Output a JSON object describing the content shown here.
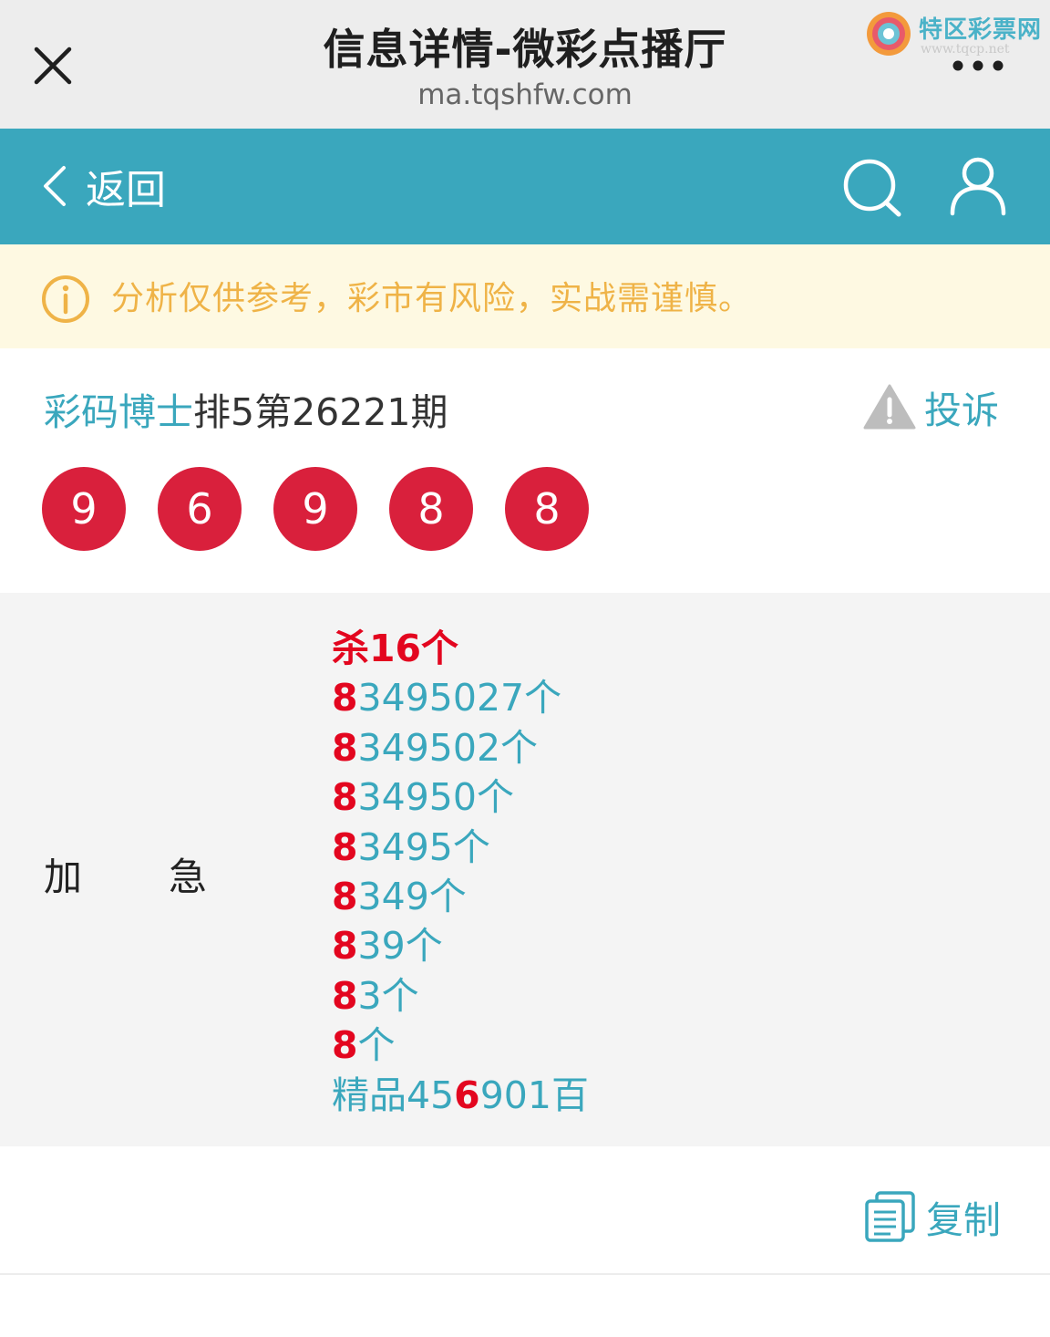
{
  "window": {
    "title": "信息详情-微彩点播厅",
    "url": "ma.tqshfw.com",
    "watermark": "特区彩票网",
    "watermark_sub": "www.tqcp.net"
  },
  "nav": {
    "back_label": "返回",
    "search_icon": "search-icon",
    "user_icon": "user-icon",
    "bg_color": "#3aa7bd"
  },
  "notice": {
    "text": "分析仅供参考，彩市有风险，实战需谨慎。",
    "icon": "info-icon",
    "text_color": "#efb347"
  },
  "post": {
    "author": "彩码博士",
    "issue": "排5第26221期",
    "complain_label": "投诉",
    "numbers": [
      "9",
      "6",
      "9",
      "8",
      "8"
    ]
  },
  "content": {
    "label_left": "加",
    "label_right": "急",
    "kill_line": "杀16个",
    "lines": [
      {
        "red": "8",
        "rest": "3495027个"
      },
      {
        "red": "8",
        "rest": "349502个"
      },
      {
        "red": "8",
        "rest": "34950个"
      },
      {
        "red": "8",
        "rest": "3495个"
      },
      {
        "red": "8",
        "rest": "349个"
      },
      {
        "red": "8",
        "rest": "39个"
      },
      {
        "red": "8",
        "rest": "3个"
      },
      {
        "red": "8",
        "rest": "个"
      }
    ],
    "final_line": {
      "prefix": "精品45",
      "red": "6",
      "suffix": "901百"
    }
  },
  "footer": {
    "copy_label": "复制"
  }
}
